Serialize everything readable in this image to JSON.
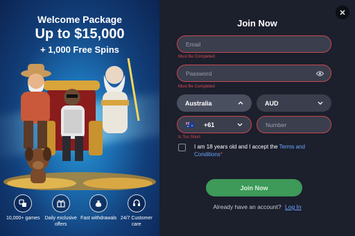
{
  "promo": {
    "headline": "Welcome Package",
    "amount": "Up to $15,000",
    "bonus": "+ 1,000 Free Spins",
    "features": [
      {
        "icon": "games-icon",
        "label": "10,000+ games"
      },
      {
        "icon": "gift-icon",
        "label": "Daily exclusive offers"
      },
      {
        "icon": "money-bag-icon",
        "label": "Fast withdrawals"
      },
      {
        "icon": "headset-icon",
        "label": "24/7 Customer care"
      }
    ]
  },
  "form": {
    "title": "Join Now",
    "email_placeholder": "Email",
    "email_error": "Must Be Completed",
    "password_placeholder": "Password",
    "password_error": "Must Be Completed",
    "country_value": "Australia",
    "currency_value": "AUD",
    "phone_code": "+61",
    "number_placeholder": "Number",
    "number_error": "Is Too Short",
    "terms_text": "I am 18 years old and I accept the",
    "terms_link": "Terms and Conditions",
    "terms_star": "*",
    "join_label": "Join Now",
    "login_prompt": "Already have an account?",
    "login_link": "Log In"
  },
  "colors": {
    "accent_green": "#3d9a58",
    "error_red": "#d94a52",
    "link_blue": "#6aa8ff"
  }
}
